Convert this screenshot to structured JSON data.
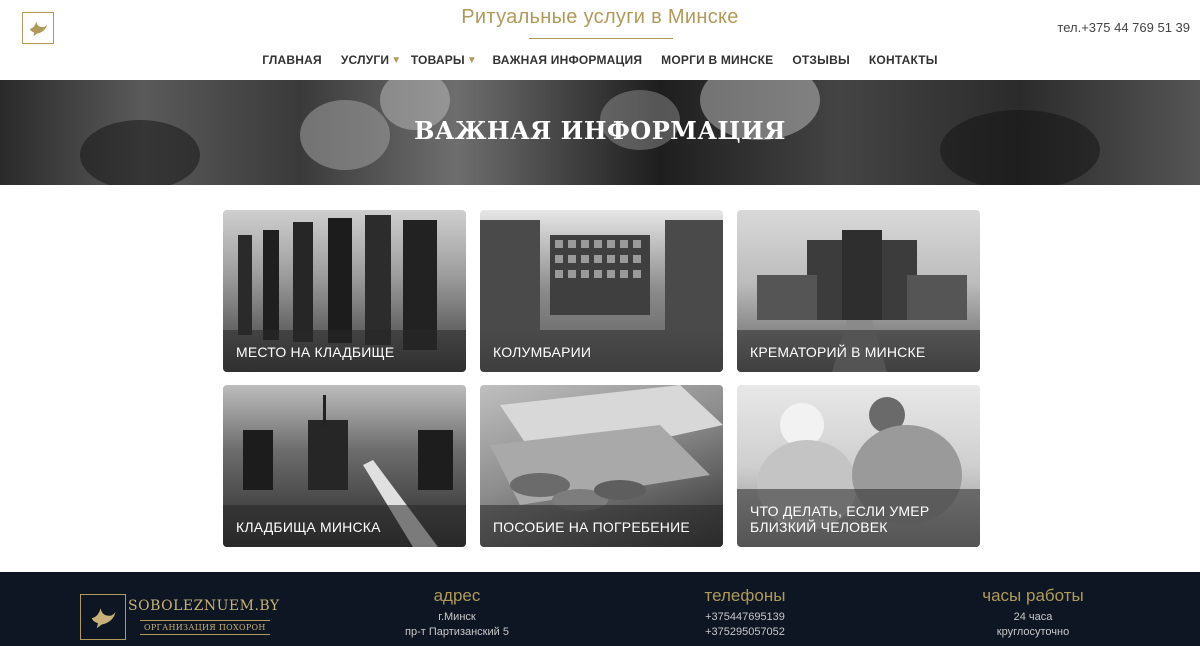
{
  "header": {
    "title": "Ритуальные услуги в Минске",
    "phone": "тел.+375 44 769 51 39",
    "nav": [
      {
        "label": "ГЛАВНАЯ",
        "dropdown": false
      },
      {
        "label": "УСЛУГИ",
        "dropdown": true
      },
      {
        "label": "ТОВАРЫ",
        "dropdown": true
      },
      {
        "label": "ВАЖНАЯ ИНФОРМАЦИЯ",
        "dropdown": false
      },
      {
        "label": "МОРГИ В МИНСКЕ",
        "dropdown": false
      },
      {
        "label": "ОТЗЫВЫ",
        "dropdown": false
      },
      {
        "label": "КОНТАКТЫ",
        "dropdown": false
      }
    ]
  },
  "hero": {
    "title": "ВАЖНАЯ ИНФОРМАЦИЯ"
  },
  "cards": [
    {
      "label": "МЕСТО НА КЛАДБИЩЕ"
    },
    {
      "label": "КОЛУМБАРИИ"
    },
    {
      "label": "КРЕМАТОРИЙ В МИНСКЕ"
    },
    {
      "label": "КЛАДБИЩА МИНСКА"
    },
    {
      "label": "ПОСОБИЕ НА ПОГРЕБЕНИЕ"
    },
    {
      "label": "ЧТО ДЕЛАТЬ, ЕСЛИ УМЕР БЛИЗКИЙ ЧЕЛОВЕК"
    }
  ],
  "footer": {
    "brand": "SOBOLEZNUEM.BY",
    "brand_sub": "ОРГАНИЗАЦИЯ ПОХОРОН",
    "address": {
      "heading": "адрес",
      "line1": "г.Минск",
      "line2": "пр-т Партизанский 5"
    },
    "phones": {
      "heading": "телефоны",
      "line1": "+375447695139",
      "line2": "+375295057052"
    },
    "hours": {
      "heading": "часы работы",
      "line1": "24 часа",
      "line2": "круглосуточно"
    }
  },
  "colors": {
    "accent_gold": "#b09a5a",
    "footer_bg": "#0d1622"
  }
}
